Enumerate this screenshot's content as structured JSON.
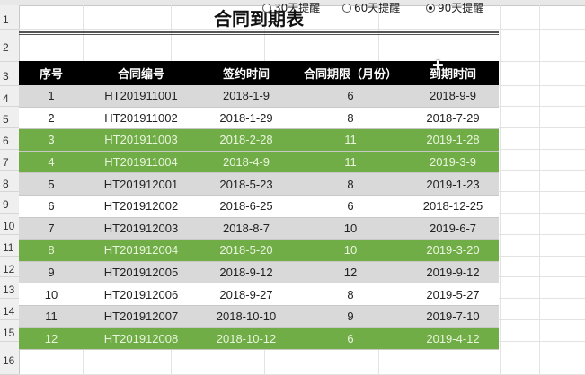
{
  "sheet": {
    "row_numbers": [
      "1",
      "2",
      "3",
      "4",
      "5",
      "6",
      "7",
      "8",
      "9",
      "10",
      "11",
      "12",
      "13",
      "14",
      "15",
      "16"
    ]
  },
  "title": "合同到期表",
  "radios": [
    {
      "label": "30天提醒",
      "selected": false
    },
    {
      "label": "60天提醒",
      "selected": false
    },
    {
      "label": "90天提醒",
      "selected": true
    }
  ],
  "table": {
    "headers": [
      "序号",
      "合同编号",
      "签约时间",
      "合同期限（月份）",
      "到期时间"
    ],
    "rows": [
      {
        "style": "gray",
        "cells": [
          "1",
          "HT201911001",
          "2018-1-9",
          "6",
          "2018-9-9"
        ]
      },
      {
        "style": "white",
        "cells": [
          "2",
          "HT201911002",
          "2018-1-29",
          "8",
          "2018-7-29"
        ]
      },
      {
        "style": "green",
        "cells": [
          "3",
          "HT201911003",
          "2018-2-28",
          "11",
          "2019-1-28"
        ]
      },
      {
        "style": "green",
        "cells": [
          "4",
          "HT201911004",
          "2018-4-9",
          "11",
          "2019-3-9"
        ]
      },
      {
        "style": "gray",
        "cells": [
          "5",
          "HT201912001",
          "2018-5-23",
          "8",
          "2019-1-23"
        ]
      },
      {
        "style": "white",
        "cells": [
          "6",
          "HT201912002",
          "2018-6-25",
          "6",
          "2018-12-25"
        ]
      },
      {
        "style": "gray",
        "cells": [
          "7",
          "HT201912003",
          "2018-8-7",
          "10",
          "2019-6-7"
        ]
      },
      {
        "style": "green",
        "cells": [
          "8",
          "HT201912004",
          "2018-5-20",
          "10",
          "2019-3-20"
        ]
      },
      {
        "style": "gray",
        "cells": [
          "9",
          "HT201912005",
          "2018-9-12",
          "12",
          "2019-9-12"
        ]
      },
      {
        "style": "white",
        "cells": [
          "10",
          "HT201912006",
          "2018-9-27",
          "8",
          "2019-5-27"
        ]
      },
      {
        "style": "gray",
        "cells": [
          "11",
          "HT201912007",
          "2018-10-10",
          "9",
          "2019-7-10"
        ]
      },
      {
        "style": "green",
        "cells": [
          "12",
          "HT201912008",
          "2018-10-12",
          "6",
          "2019-4-12"
        ]
      }
    ]
  },
  "colors": {
    "header_bg": "#000000",
    "highlight_green": "#70ad47",
    "row_gray": "#d9d9d9"
  }
}
